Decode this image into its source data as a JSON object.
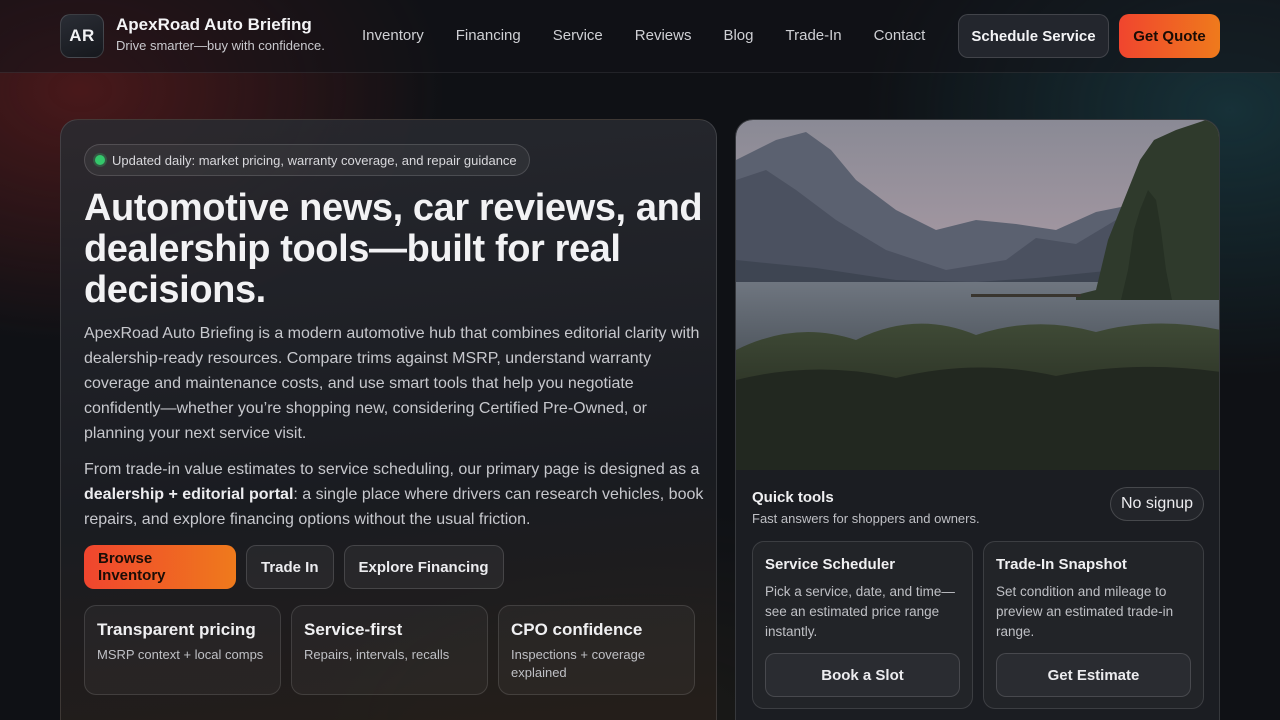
{
  "header": {
    "logo_initials": "AR",
    "brand_name": "ApexRoad Auto Briefing",
    "tagline": "Drive smarter—buy with confidence.",
    "nav": [
      "Inventory",
      "Financing",
      "Service",
      "Reviews",
      "Blog",
      "Trade-In",
      "Contact"
    ],
    "schedule_label": "Schedule Service",
    "quote_label": "Get Quote"
  },
  "hero": {
    "pill_text": "Updated daily: market pricing, warranty coverage, and repair guidance",
    "title": "Automotive news, car reviews, and dealership tools—built for real decisions.",
    "para1": "ApexRoad Auto Briefing is a modern automotive hub that combines editorial clarity with dealership-ready resources. Compare trims against MSRP, understand warranty coverage and maintenance costs, and use smart tools that help you negotiate confidently—whether you’re shopping new, considering Certified Pre-Owned, or planning your next service visit.",
    "para2_start": "From trade-in value estimates to service scheduling, our primary page is designed as a ",
    "para2_bold": "dealership + editorial portal",
    "para2_end": ": a single place where drivers can research vehicles, book repairs, and explore financing options without the usual friction.",
    "cta_primary": "Browse Inventory",
    "cta_trade": "Trade In",
    "cta_financing": "Explore Financing",
    "features": [
      {
        "title": "Transparent pricing",
        "desc": "MSRP context + local comps"
      },
      {
        "title": "Service-first",
        "desc": "Repairs, intervals, recalls"
      },
      {
        "title": "CPO confidence",
        "desc": "Inspections + coverage explained"
      }
    ]
  },
  "tools": {
    "title": "Quick tools",
    "subtitle": "Fast answers for shoppers and owners.",
    "badge": "No signup",
    "cards": [
      {
        "title": "Service Scheduler",
        "desc": "Pick a service, date, and time—see an estimated price range instantly.",
        "button": "Book a Slot"
      },
      {
        "title": "Trade-In Snapshot",
        "desc": "Set condition and mileage to preview an estimated trade-in range.",
        "button": "Get Estimate"
      }
    ]
  },
  "colors": {
    "accent_start": "#f0452e",
    "accent_end": "#ef7a1c",
    "status_dot": "#34c76b",
    "background": "#0f1115"
  }
}
